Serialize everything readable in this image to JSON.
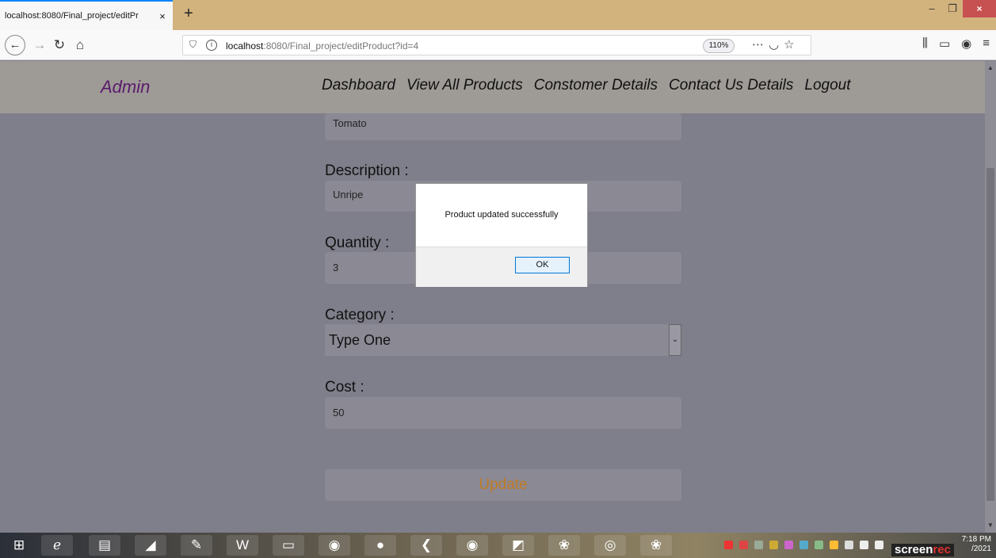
{
  "browser": {
    "tab_title": "localhost:8080/Final_project/editPr",
    "tab_close": "×",
    "new_tab": "+",
    "url_host": "localhost",
    "url_rest": ":8080/Final_project/editProduct?id=4",
    "zoom": "110%",
    "window_buttons": {
      "minimize": "–",
      "restore": "❐",
      "close": "×"
    }
  },
  "header": {
    "brand": "Admin",
    "menu": [
      "Dashboard",
      "View All Products",
      "Constomer Details",
      "Contact Us Details",
      "Logout"
    ]
  },
  "form": {
    "name_value": "Tomato",
    "description_label": "Description :",
    "description_value": "Unripe",
    "quantity_label": "Quantity :",
    "quantity_value": "3",
    "category_label": "Category :",
    "category_value": "Type One",
    "cost_label": "Cost :",
    "cost_value": "50",
    "update_label": "Update"
  },
  "dialog": {
    "message": "Product updated successfully",
    "ok_label": "OK"
  },
  "taskbar": {
    "time": "7:18 PM",
    "date": "/2021",
    "watermark_a": "screen",
    "watermark_b": "rec"
  },
  "colors": {
    "accent": "#0a84ff",
    "brand": "#5a1a6b",
    "update_text": "#c07a22",
    "tabbar": "#d3b37d"
  },
  "icons": [
    "back-icon",
    "forward-icon",
    "reload-icon",
    "home-icon",
    "shield-icon",
    "info-icon",
    "more-icon",
    "pocket-icon",
    "star-icon",
    "library-icon",
    "sidebar-icon",
    "account-icon",
    "menu-icon"
  ]
}
